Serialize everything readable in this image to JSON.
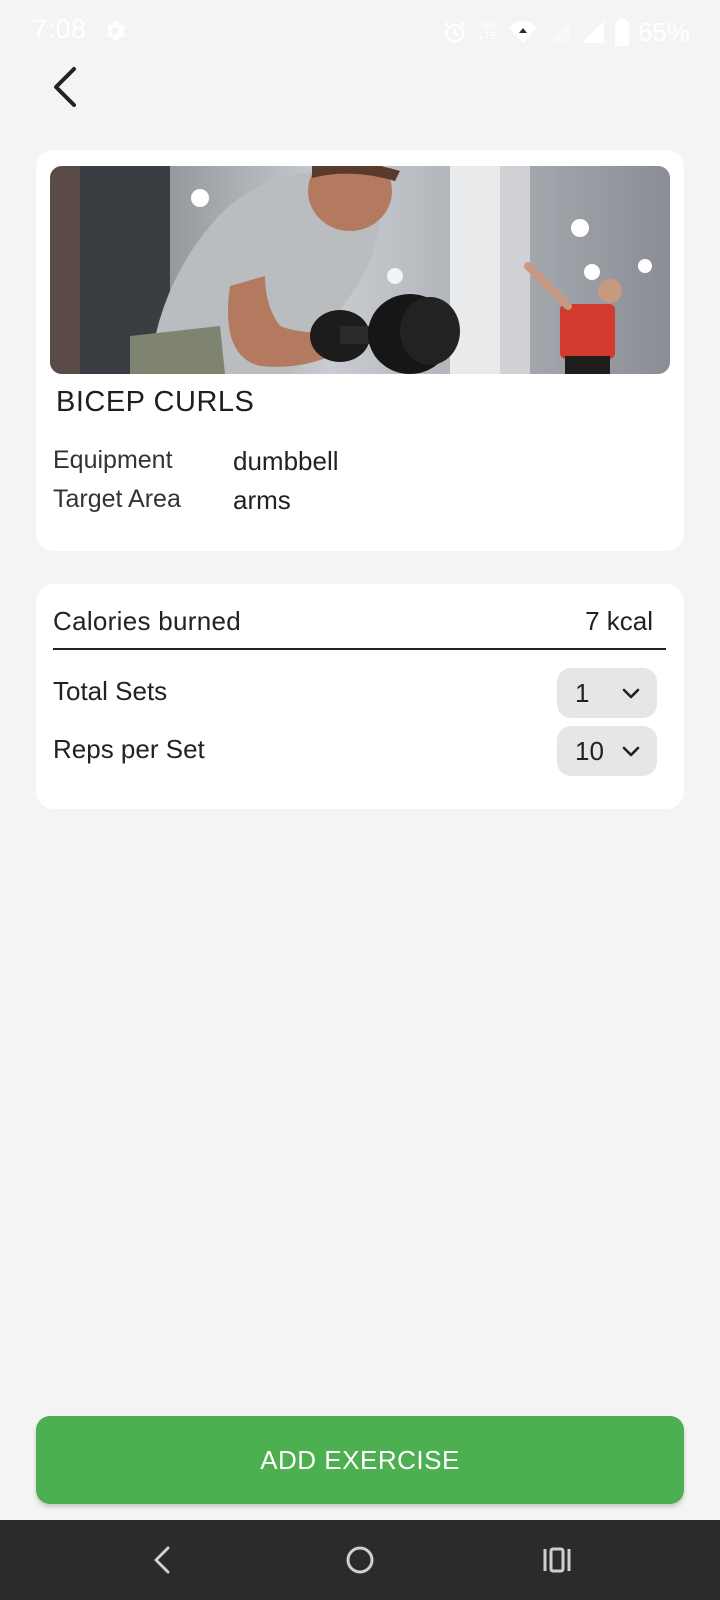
{
  "status_bar": {
    "time": "7:08",
    "volte": "Vo)\nLTE",
    "battery": "65%"
  },
  "exercise": {
    "name": "BICEP CURLS",
    "image_alt": "man-doing-dumbbell-curl-photo",
    "details": [
      {
        "label": "Equipment",
        "value": "dumbbell"
      },
      {
        "label": "Target Area",
        "value": "arms"
      }
    ]
  },
  "stats": {
    "calories_label": "Calories burned",
    "calories_value": "7 kcal",
    "sets_label": "Total Sets",
    "sets_value": "1",
    "reps_label": "Reps per Set",
    "reps_value": "10"
  },
  "actions": {
    "add_label": "ADD EXERCISE"
  },
  "colors": {
    "accent": "#4caf50",
    "background": "#f4f4f2",
    "nav_bar": "#2b2b2b"
  }
}
